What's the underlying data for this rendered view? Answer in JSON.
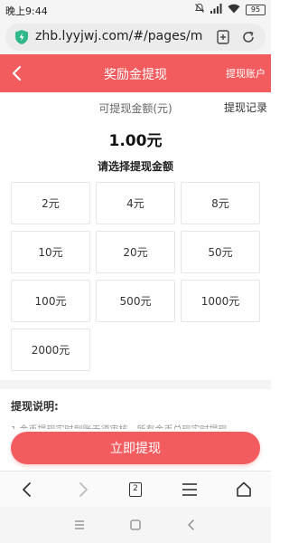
{
  "status": {
    "time": "晚上9:44",
    "battery": "95",
    "icons": [
      "mute-icon",
      "signal-icon",
      "wifi-icon",
      "battery-icon"
    ]
  },
  "browser": {
    "url": "zhb.lyyjwj.com/#/pages/m",
    "tab_count": "2",
    "icons": [
      "shield-icon",
      "add-bookmark-icon",
      "refresh-icon",
      "back-icon",
      "forward-icon",
      "tabs-icon",
      "menu-icon",
      "home-icon"
    ]
  },
  "header": {
    "title": "奖励金提现",
    "account_link": "提现账户"
  },
  "balance": {
    "label": "可提现金额(元)",
    "records_link": "提现记录",
    "amount": "1.00元"
  },
  "choose_label": "请选择提现金额",
  "options": [
    "2元",
    "4元",
    "8元",
    "10元",
    "20元",
    "50元",
    "100元",
    "500元",
    "1000元",
    "2000元"
  ],
  "info": {
    "title": "提现说明:",
    "line1": "1.金币提现实时到账无须审核，所有金币兑现实时提现"
  },
  "submit_label": "立即提现",
  "colors": {
    "accent": "#f25c5e",
    "background": "#ffffff",
    "separator": "#f4f4f4"
  }
}
